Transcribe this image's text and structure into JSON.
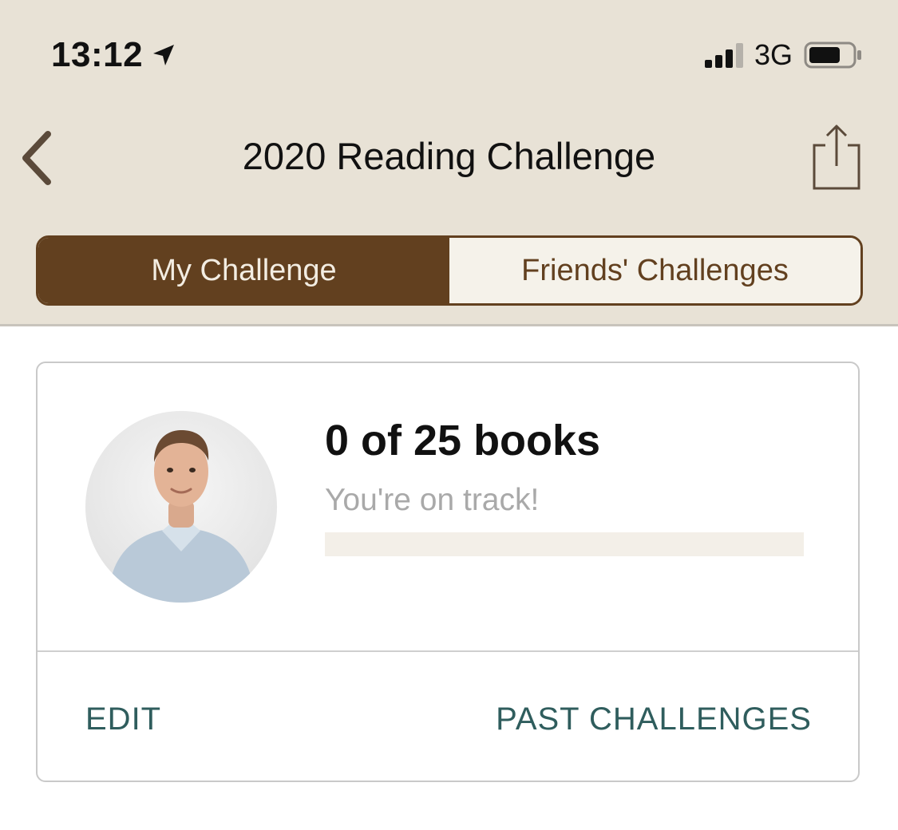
{
  "status_bar": {
    "time": "13:12",
    "network": "3G",
    "icons": [
      "location-arrow-icon",
      "signal-bars-icon",
      "battery-icon"
    ],
    "battery_level": 0.7
  },
  "nav": {
    "title": "2020 Reading Challenge",
    "back_icon": "chevron-left-icon",
    "share_icon": "share-icon"
  },
  "tabs": [
    {
      "label": "My Challenge",
      "active": true
    },
    {
      "label": "Friends' Challenges",
      "active": false
    }
  ],
  "challenge": {
    "books_text": "0 of 25 books",
    "status": "You're on track!",
    "books_read": 0,
    "books_goal": 25,
    "progress": 0.0
  },
  "actions": {
    "edit_label": "EDIT",
    "past_label": "PAST CHALLENGES"
  },
  "colors": {
    "brand_brown": "#62401f",
    "header_bg": "#e8e2d6",
    "action_teal": "#2f5d5d"
  }
}
